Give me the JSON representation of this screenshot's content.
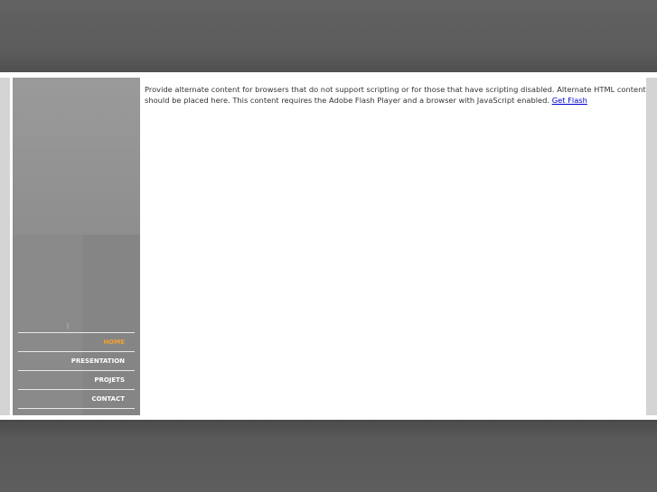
{
  "nav": {
    "items": [
      {
        "label": "HOME",
        "active": true
      },
      {
        "label": "PRESENTATION",
        "active": false
      },
      {
        "label": "PROJETS",
        "active": false
      },
      {
        "label": "CONTACT",
        "active": false
      }
    ],
    "active_color": "#f2a033"
  },
  "content": {
    "message": "Provide alternate content for browsers that do not support scripting or for those that have scripting disabled. Alternate HTML content should be placed here. This content requires the Adobe Flash Player and a browser with JavaScript enabled.",
    "link_label": "Get Flash"
  },
  "colors": {
    "background": "#5f5f5f",
    "panel": "#ffffff",
    "sidebar": "#8a8a8a",
    "rail": "#d4d4d4",
    "link": "#0000cc"
  }
}
